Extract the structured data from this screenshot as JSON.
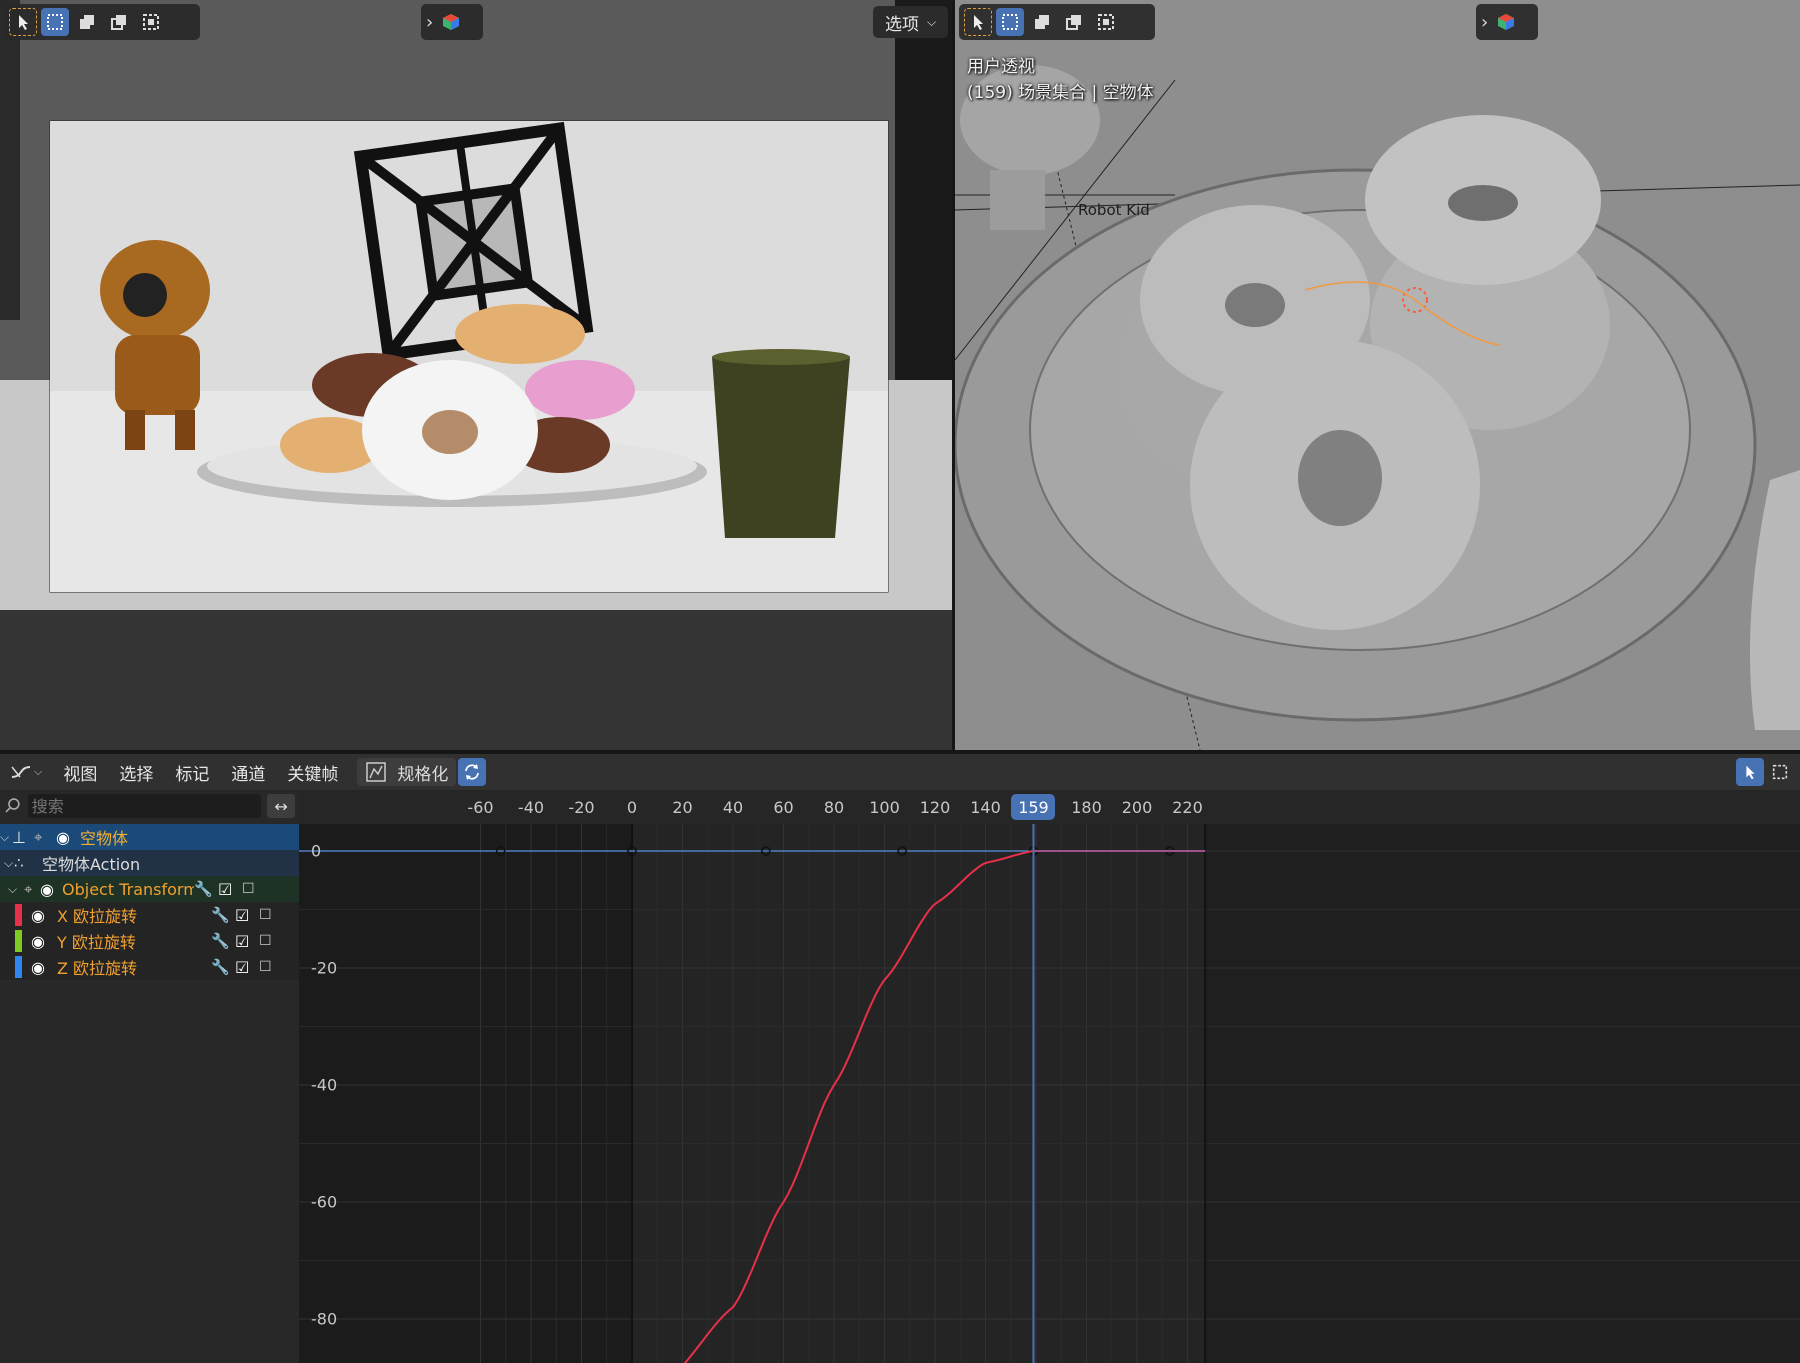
{
  "left_viewport": {
    "options_label": "选项"
  },
  "right_viewport": {
    "view_name": "用户透视",
    "frame_info": "(159) 场景集合 | 空物体",
    "object_label": "Robot Kid"
  },
  "graph_editor": {
    "menu": [
      "视图",
      "选择",
      "标记",
      "通道",
      "关键帧"
    ],
    "normalize_label": "规格化",
    "search_placeholder": "搜索",
    "current_frame": "159",
    "ruler_ticks": [
      "-60",
      "-40",
      "-20",
      "0",
      "20",
      "40",
      "60",
      "80",
      "100",
      "120",
      "140",
      "159",
      "180",
      "200",
      "220"
    ],
    "y_ticks": [
      "0",
      "-20",
      "-40",
      "-60",
      "-80"
    ],
    "channels": {
      "object": "空物体",
      "action": "空物体Action",
      "group": "Object Transforms",
      "curves": [
        {
          "name": "X 欧拉旋转",
          "color": "#e8304a"
        },
        {
          "name": "Y 欧拉旋转",
          "color": "#7dcc20"
        },
        {
          "name": "Z 欧拉旋转",
          "color": "#2f86f0"
        }
      ]
    },
    "colors": {
      "accent": "#4772b3",
      "selected_row": "#1c4a78",
      "group_text": "#f0a030",
      "curve_x": "#e8304a"
    }
  },
  "chart_data": {
    "type": "line",
    "xlabel": "",
    "ylabel": "",
    "xlim": [
      -65,
      225
    ],
    "ylim": [
      -90,
      2
    ],
    "grid": true,
    "series": [
      {
        "name": "X 欧拉旋转",
        "x": [
          15,
          40,
          60,
          80,
          100,
          120,
          140,
          159
        ],
        "y": [
          -90,
          -78,
          -60,
          -40,
          -22,
          -9,
          -2,
          0
        ]
      },
      {
        "name": "Z 欧拉旋转",
        "x": [
          -52,
          0,
          53,
          107,
          159,
          213
        ],
        "y": [
          0,
          0,
          0,
          0,
          0,
          0
        ]
      }
    ]
  }
}
